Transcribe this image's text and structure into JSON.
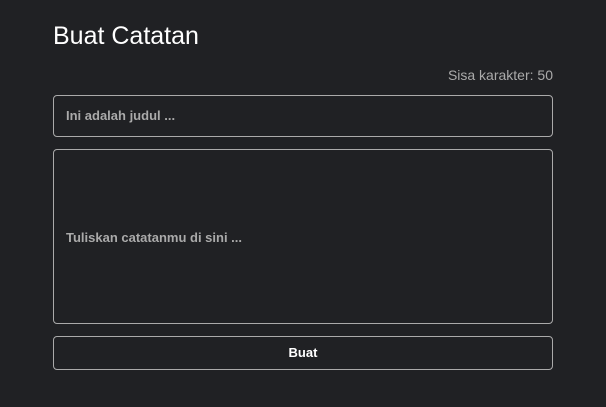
{
  "form": {
    "title": "Buat Catatan",
    "char_limit_text": "Sisa karakter: 50",
    "title_placeholder": "Ini adalah judul ...",
    "body_placeholder": "Tuliskan catatanmu di sini ...",
    "submit_label": "Buat"
  },
  "colors": {
    "background": "#202124",
    "text": "#ffffff",
    "muted": "#aaaaaa",
    "border": "#aaaaaa"
  }
}
